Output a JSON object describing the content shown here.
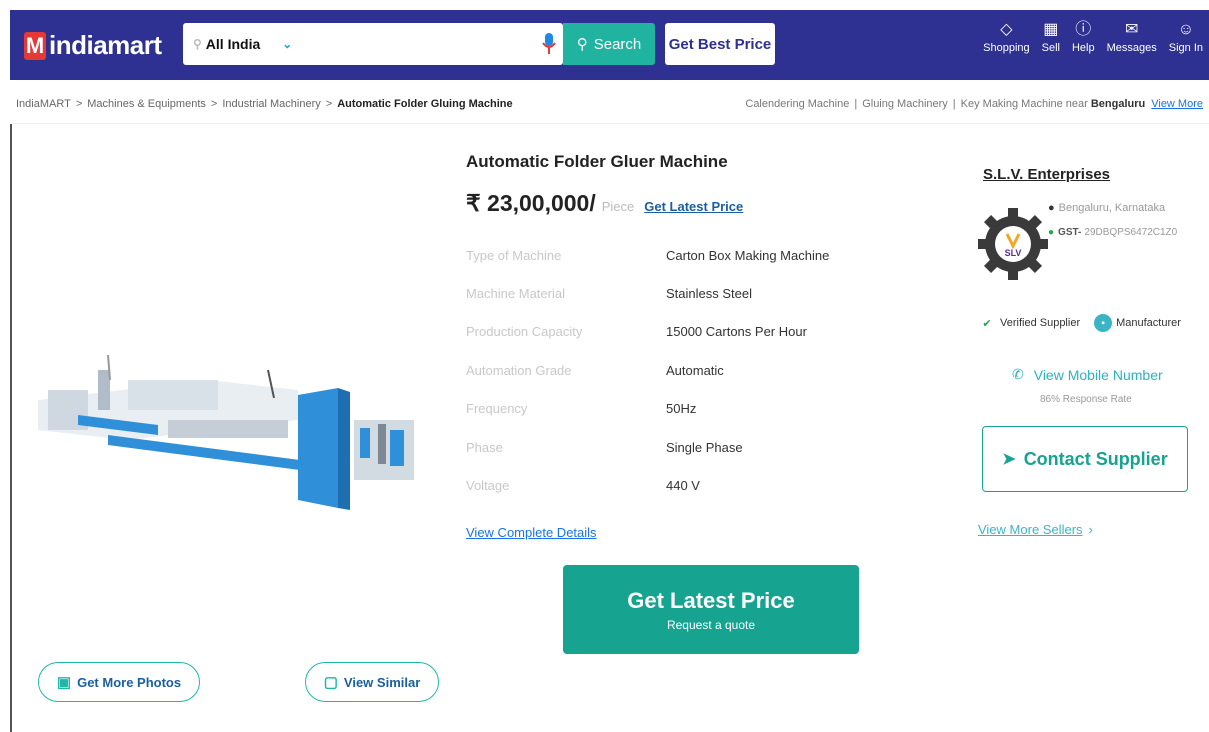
{
  "header": {
    "logo_text": "indiamart",
    "location": "All India",
    "search_placeholder": "",
    "search_label": "Search",
    "best_price_label": "Get Best Price",
    "nav": [
      {
        "label": "Shopping",
        "icon": "shopping-icon"
      },
      {
        "label": "Sell",
        "icon": "sell-icon"
      },
      {
        "label": "Help",
        "icon": "help-icon"
      },
      {
        "label": "Messages",
        "icon": "messages-icon"
      },
      {
        "label": "Sign In",
        "icon": "user-icon"
      }
    ]
  },
  "breadcrumb": {
    "items": [
      "IndiaMART",
      "Machines & Equipments",
      "Industrial Machinery",
      "Automatic Folder Gluing Machine"
    ],
    "separator": ">",
    "related": [
      "Calendering Machine",
      "Gluing Machinery",
      "Key Making Machine near"
    ],
    "related_city": "Bengaluru",
    "view_more": "View More"
  },
  "product": {
    "title": "Automatic Folder Gluer Machine",
    "price": "₹ 23,00,000/",
    "unit": "Piece",
    "latest_price_link": "Get Latest Price",
    "specs": [
      {
        "key": "Type of Machine",
        "value": "Carton Box Making Machine"
      },
      {
        "key": "Machine Material",
        "value": "Stainless Steel"
      },
      {
        "key": "Production Capacity",
        "value": "15000 Cartons Per Hour"
      },
      {
        "key": "Automation Grade",
        "value": "Automatic"
      },
      {
        "key": "Frequency",
        "value": "50Hz"
      },
      {
        "key": "Phase",
        "value": "Single Phase"
      },
      {
        "key": "Voltage",
        "value": "440 V"
      }
    ],
    "view_details": "View Complete Details",
    "cta_main": "Get Latest Price",
    "cta_sub": "Request a quote",
    "more_photos": "Get More Photos",
    "view_similar": "View Similar"
  },
  "supplier": {
    "name": "S.L.V. Enterprises",
    "logo_text": "SLV",
    "location": "Bengaluru, Karnataka",
    "gst_label": "GST-",
    "gst_value": "29DBQPS6472C1Z0",
    "verified": "Verified Supplier",
    "type": "Manufacturer",
    "mobile": "View Mobile Number",
    "response_rate": "86% Response Rate",
    "contact": "Contact Supplier",
    "more_sellers": "View More Sellers"
  },
  "colors": {
    "header_bg": "#2e3192",
    "accent": "#16a38f",
    "link": "#1a5f9e",
    "logo_red": "#e53935"
  }
}
